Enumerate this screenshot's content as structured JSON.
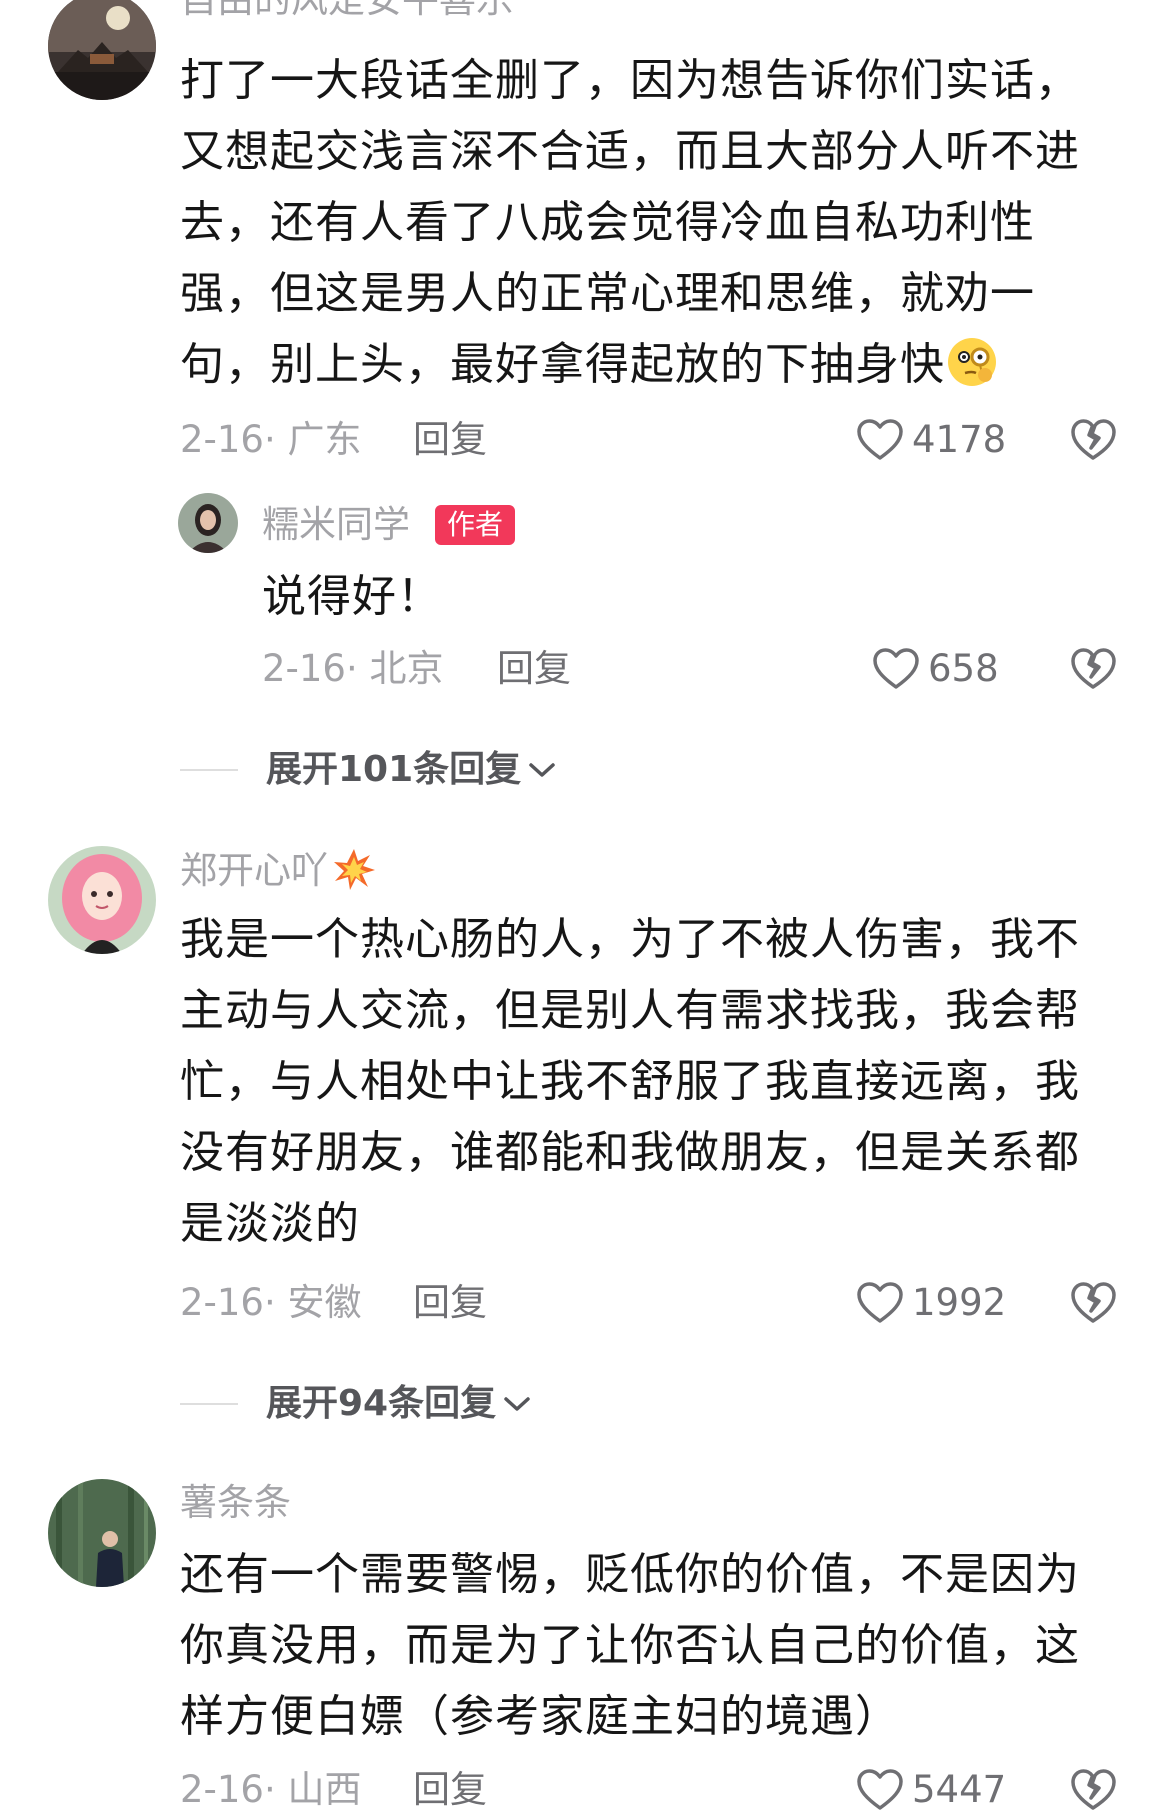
{
  "comments": [
    {
      "username": "自由的风是安平喜乐",
      "text_lines": [
        "打了一大段话全删了，因为想告诉你们实话，",
        "又想起交浅言深不合适，而且大部分人听不进",
        "去，还有人看了八成会觉得冷血自私功利性",
        "强，但这是男人的正常心理和思维，就劝一",
        "句，别上头，最好拿得起放的下抽身快"
      ],
      "date_location": "2-16· 广东",
      "reply_label": "回复",
      "likes": "4178",
      "reply": {
        "username": "糯米同学",
        "badge": "作者",
        "text": "说得好！",
        "date_location": "2-16· 北京",
        "reply_label": "回复",
        "likes": "658"
      },
      "expand_label": "展开101条回复"
    },
    {
      "username": "郑开心吖",
      "text_lines": [
        "我是一个热心肠的人，为了不被人伤害，我不",
        "主动与人交流，但是别人有需求找我，我会帮",
        "忙，与人相处中让我不舒服了我直接远离，我",
        "没有好朋友，谁都能和我做朋友，但是关系都",
        "是淡淡的"
      ],
      "date_location": "2-16· 安徽",
      "reply_label": "回复",
      "likes": "1992",
      "expand_label": "展开94条回复"
    },
    {
      "username": "薯条条",
      "text_lines": [
        "还有一个需要警惕，贬低你的价值，不是因为",
        "你真没用，而是为了让你否认自己的价值，这",
        "样方便白嫖（参考家庭主妇的境遇）"
      ],
      "date_location": "2-16· 山西",
      "reply_label": "回复",
      "likes": "5447"
    }
  ],
  "colors": {
    "badge": "#f2385a",
    "muted": "#a3a3a7",
    "text": "#161616"
  },
  "icons": [
    "heart-outline-icon",
    "broken-heart-icon",
    "chevron-down-icon",
    "monocle-face-emoji",
    "collision-emoji"
  ]
}
